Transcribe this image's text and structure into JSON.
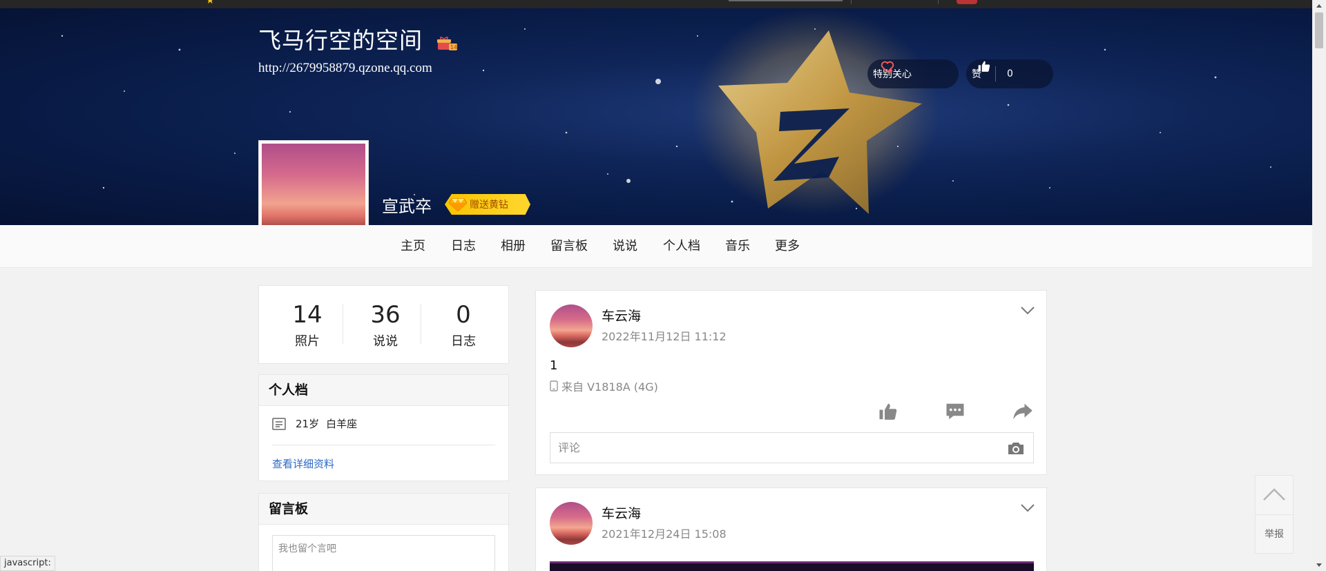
{
  "header": {
    "space_title": "飞马行空的空间",
    "space_url": "http://2679958879.qzone.qq.com",
    "title_badge_icon": "gift-box-icon",
    "special_care_label": "特别关心",
    "like_label": "赞",
    "like_count": "0"
  },
  "owner": {
    "name": "宣武卒",
    "gift_vip_label": "赠送黄钻"
  },
  "nav": {
    "items": [
      {
        "label": "主页"
      },
      {
        "label": "日志"
      },
      {
        "label": "相册"
      },
      {
        "label": "留言板"
      },
      {
        "label": "说说"
      },
      {
        "label": "个人档"
      },
      {
        "label": "音乐"
      },
      {
        "label": "更多"
      }
    ]
  },
  "stats": [
    {
      "value": "14",
      "label": "照片"
    },
    {
      "value": "36",
      "label": "说说"
    },
    {
      "value": "0",
      "label": "日志"
    }
  ],
  "profile": {
    "heading": "个人档",
    "age": "21岁",
    "zodiac": "白羊座",
    "detail_link": "查看详细资料"
  },
  "guestbook": {
    "heading": "留言板",
    "placeholder": "我也留个言吧"
  },
  "feeds": [
    {
      "author": "车云海",
      "time": "2022年11月12日 11:12",
      "text": "1",
      "source": "来自 V1818A (4G)",
      "comment_placeholder": "评论"
    },
    {
      "author": "车云海",
      "time": "2021年12月24日 15:08"
    }
  ],
  "side_tools": {
    "report_label": "举报"
  },
  "status_bar": {
    "text": "javascript:"
  },
  "colors": {
    "banner_bg": "#0f2558",
    "link_blue": "#2a68c8",
    "vip_gold": "#f8c400",
    "text_dark": "#222222",
    "text_muted": "#888888"
  }
}
